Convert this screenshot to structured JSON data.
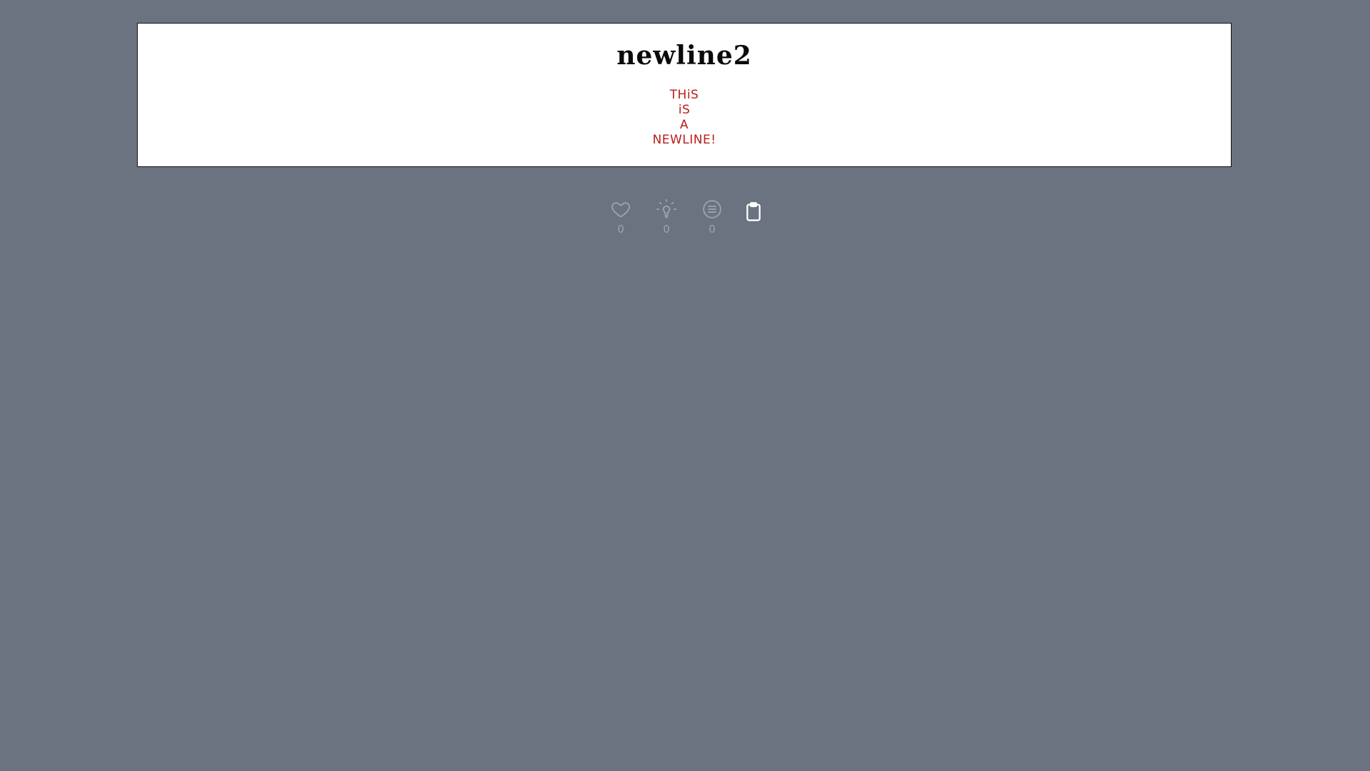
{
  "post": {
    "title": "newline2",
    "lines": [
      "THiS",
      "iS",
      "A",
      "NEWLINE!"
    ]
  },
  "actions": {
    "likes": {
      "icon": "heart-icon",
      "count": "0"
    },
    "ideas": {
      "icon": "lightbulb-icon",
      "count": "0"
    },
    "comments": {
      "icon": "comment-list-icon",
      "count": "0"
    },
    "copy": {
      "icon": "clipboard-icon"
    }
  },
  "colors": {
    "background": "#6b7280",
    "card": "#ffffff",
    "title": "#0a0a0a",
    "body_text": "#b91c1c",
    "muted": "#9ca3af"
  }
}
